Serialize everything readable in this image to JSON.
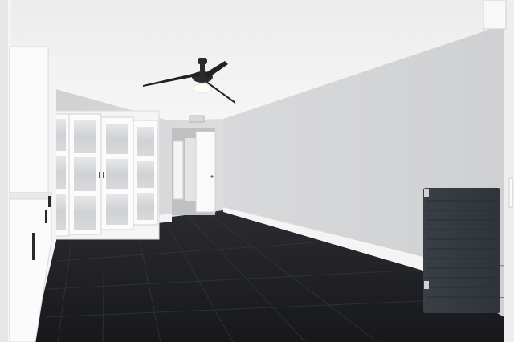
{
  "photo": {
    "subject": "empty-room-interior",
    "palette": {
      "ceiling": "#f1f1f1",
      "wall": "#d6d7d9",
      "floor": "#1f2024",
      "trim": "#f7f7f7",
      "door_glass": "#d9dadc",
      "radiator": "#3a3f46",
      "fan": "#2b2b2b"
    }
  }
}
